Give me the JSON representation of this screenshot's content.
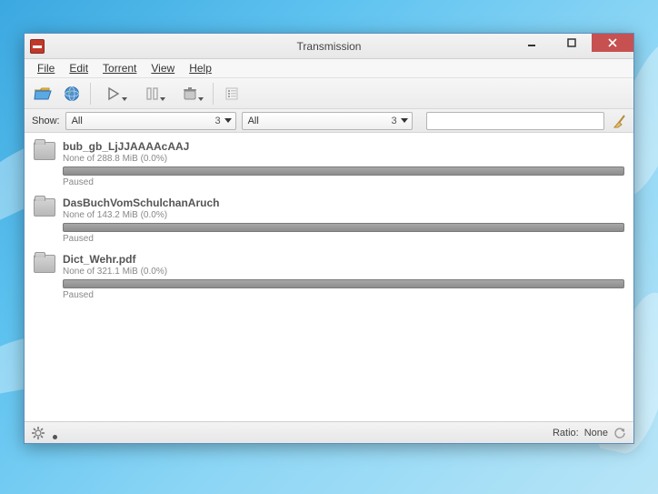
{
  "window": {
    "title": "Transmission"
  },
  "menu": {
    "file": "File",
    "edit": "Edit",
    "torrent": "Torrent",
    "view": "View",
    "help": "Help"
  },
  "filter": {
    "label": "Show:",
    "primary_value": "All",
    "primary_count": "3",
    "secondary_value": "All",
    "secondary_count": "3",
    "search_placeholder": ""
  },
  "torrents": [
    {
      "name": "bub_gb_LjJJAAAAcAAJ",
      "status": "None of 288.8 MiB (0.0%)",
      "state": "Paused"
    },
    {
      "name": "DasBuchVomSchulchanAruch",
      "status": "None of 143.2 MiB (0.0%)",
      "state": "Paused"
    },
    {
      "name": "Dict_Wehr.pdf",
      "status": "None of 321.1 MiB (0.0%)",
      "state": "Paused"
    }
  ],
  "statusbar": {
    "ratio_label": "Ratio:",
    "ratio_value": "None"
  }
}
